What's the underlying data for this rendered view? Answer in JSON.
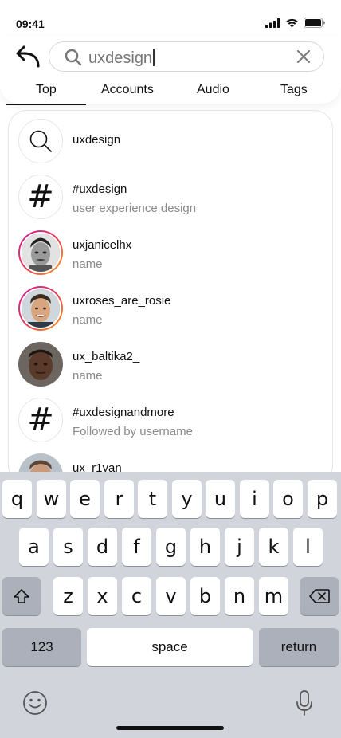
{
  "status": {
    "time": "09:41"
  },
  "search": {
    "query": "uxdesign"
  },
  "tabs": [
    {
      "label": "Top",
      "active": true
    },
    {
      "label": "Accounts",
      "active": false
    },
    {
      "label": "Audio",
      "active": false
    },
    {
      "label": "Tags",
      "active": false
    }
  ],
  "results": [
    {
      "type": "search",
      "title": "uxdesign",
      "subtitle": ""
    },
    {
      "type": "tag",
      "title": "#uxdesign",
      "subtitle": "user experience design"
    },
    {
      "type": "user",
      "title": "uxjanicelhx",
      "subtitle": "name",
      "story": true
    },
    {
      "type": "user",
      "title": "uxroses_are_rosie",
      "subtitle": "name",
      "story": true
    },
    {
      "type": "user",
      "title": "ux_baltika2_",
      "subtitle": "name",
      "story": false
    },
    {
      "type": "tag",
      "title": "#uxdesignandmore",
      "subtitle": "Followed by username"
    },
    {
      "type": "user",
      "title": "ux_r1yan",
      "subtitle": "",
      "story": false
    }
  ],
  "keyboard": {
    "row1": [
      "q",
      "w",
      "e",
      "r",
      "t",
      "y",
      "u",
      "i",
      "o",
      "p"
    ],
    "row2": [
      "a",
      "s",
      "d",
      "f",
      "g",
      "h",
      "j",
      "k",
      "l"
    ],
    "row3": [
      "z",
      "x",
      "c",
      "v",
      "b",
      "n",
      "m"
    ],
    "numbers_label": "123",
    "space_label": "space",
    "return_label": "return"
  },
  "colors": {
    "story_ring": [
      "#d4189c",
      "#f8a11b"
    ],
    "keyboard_bg": "#d1d4da",
    "secondary_text": "#8a8a8a"
  },
  "icons": {
    "back": "back-arrow-icon",
    "search": "search-icon",
    "clear": "close-icon",
    "shift": "shift-icon",
    "delete": "backspace-icon",
    "emoji": "emoji-icon",
    "mic": "microphone-icon"
  }
}
